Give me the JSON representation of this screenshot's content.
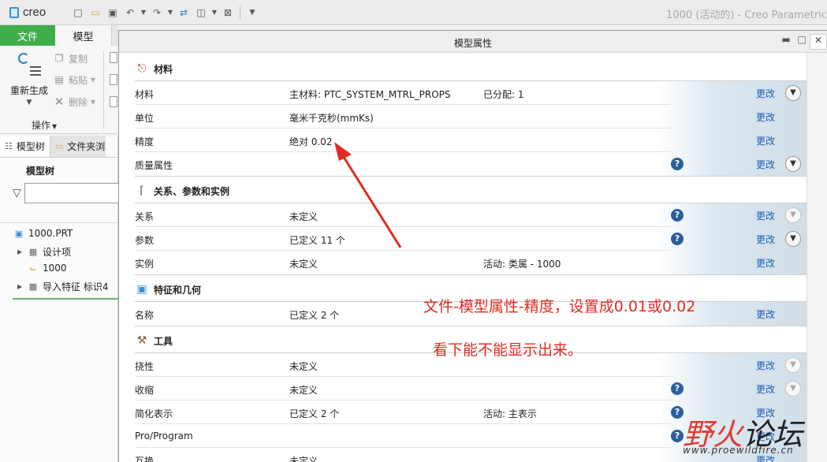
{
  "app": {
    "logo": "creo",
    "window_title": "1000 (活动的) - Creo Parametric"
  },
  "ribbon": {
    "tabs": {
      "file": "文件",
      "model": "模型"
    },
    "regenerate": "重新生成",
    "copy": "复制",
    "paste": "粘贴",
    "delete": "删除",
    "operations_group": "操作"
  },
  "left_panel": {
    "tabs": {
      "model_tree": "模型树",
      "folder_browser": "文件夹浏览器"
    },
    "heading": "模型树",
    "filter_placeholder": "",
    "tree": [
      {
        "label": "1000.PRT",
        "icon": "part-icon"
      },
      {
        "label": "设计项",
        "icon": "design-items-icon"
      },
      {
        "label": "1000",
        "icon": "csys-icon"
      },
      {
        "label": "导入特征 标识4",
        "icon": "import-feature-icon"
      }
    ]
  },
  "dialog": {
    "title": "模型属性",
    "change_label": "更改",
    "sections": {
      "materials": {
        "title": "材料",
        "rows": [
          {
            "label": "材料",
            "value": "主材料: PTC_SYSTEM_MTRL_PROPS",
            "value2": "已分配: 1"
          },
          {
            "label": "单位",
            "value": "毫米千克秒(mmKs)"
          },
          {
            "label": "精度",
            "value": "绝对 0.02"
          },
          {
            "label": "质量属性",
            "value": ""
          }
        ]
      },
      "relations": {
        "title": "关系、参数和实例",
        "rows": [
          {
            "label": "关系",
            "value": "未定义"
          },
          {
            "label": "参数",
            "value": "已定义 11 个"
          },
          {
            "label": "实例",
            "value": "未定义",
            "value2": "活动: 类属 - 1000"
          }
        ]
      },
      "features": {
        "title": "特征和几何",
        "rows": [
          {
            "label": "名称",
            "value": "已定义 2 个"
          }
        ]
      },
      "tools": {
        "title": "工具",
        "rows": [
          {
            "label": "挠性",
            "value": "未定义"
          },
          {
            "label": "收缩",
            "value": "未定义"
          },
          {
            "label": "简化表示",
            "value": "已定义 2 个",
            "value2": "活动: 主表示"
          },
          {
            "label": "Pro/Program",
            "value": ""
          },
          {
            "label": "互换",
            "value": "未定义"
          }
        ]
      }
    }
  },
  "annotation": {
    "line1": "文件-模型属性-精度，设置成0.01或0.02",
    "line2": "看下能不能显示出来。",
    "color": "#e32b22"
  },
  "watermark": {
    "brand_red": "野火",
    "brand_dark": "论坛",
    "url": "www.proewildfire.cn"
  }
}
